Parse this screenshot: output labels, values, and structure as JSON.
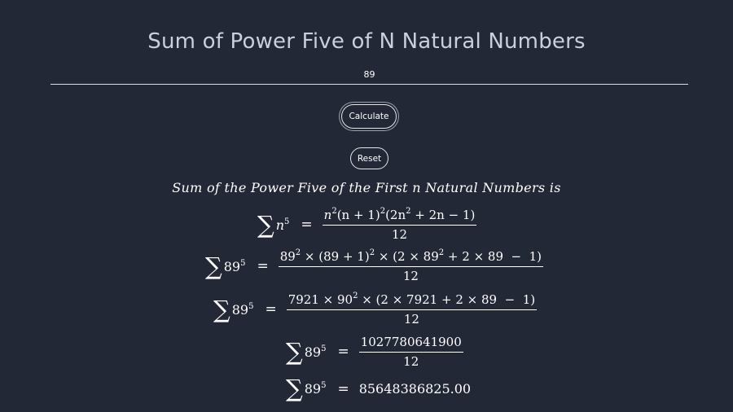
{
  "title": "Sum of Power Five of N Natural Numbers",
  "input": {
    "value": "89"
  },
  "buttons": {
    "calculate": "Calculate",
    "reset": "Reset"
  },
  "result": {
    "heading": "Sum of the Power Five of the First n Natural Numbers is",
    "sigma": "∑",
    "equals": "=",
    "formula": {
      "lhs_base": "n",
      "lhs_exp": "5",
      "num_a": "n",
      "num_a_exp": "2",
      "num_b": "(n + 1)",
      "num_b_exp": "2",
      "num_c": "(2n",
      "num_c_exp": "2",
      "num_d": " + 2n − 1)",
      "den": "12"
    },
    "step1": {
      "lhs_base": "89",
      "lhs_exp": "5",
      "num_a": "89",
      "num_a_exp": "2",
      "num_b": " × (89 + 1)",
      "num_b_exp": "2",
      "num_c": " × (2 × 89",
      "num_c_exp": "2",
      "num_d": " + 2 × 89  −  1)",
      "den": "12"
    },
    "step2": {
      "lhs_base": "89",
      "lhs_exp": "5",
      "num_a": "7921 × 90",
      "num_a_exp": "2",
      "num_b": " × (2 × 7921 + 2 × 89  −  1)",
      "den": "12"
    },
    "step3": {
      "lhs_base": "89",
      "lhs_exp": "5",
      "num": "1027780641900",
      "den": "12"
    },
    "step4": {
      "lhs_base": "89",
      "lhs_exp": "5",
      "value": "85648386825.00"
    }
  }
}
